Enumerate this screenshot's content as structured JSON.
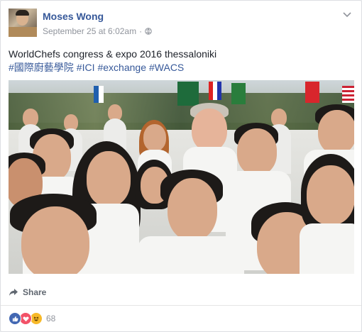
{
  "post": {
    "author": "Moses Wong",
    "timestamp": "September 25 at 6:02am",
    "separator": "·",
    "privacy_icon": "globe-icon",
    "menu_icon": "chevron-down-icon",
    "text_line1": "WorldChefs congress & expo 2016 thessaloniki",
    "hashtags": [
      "#國際廚藝學院",
      "#ICI",
      "#exchange",
      "#WACS"
    ]
  },
  "actions": {
    "share_label": "Share",
    "share_icon": "share-arrow-icon"
  },
  "reactions": {
    "types": [
      "like",
      "love",
      "haha"
    ],
    "count": "68"
  },
  "colors": {
    "link": "#365899",
    "text": "#1d2129",
    "meta": "#90949c",
    "like": "#4267b2",
    "love": "#f25268",
    "haha": "#f7b928"
  }
}
